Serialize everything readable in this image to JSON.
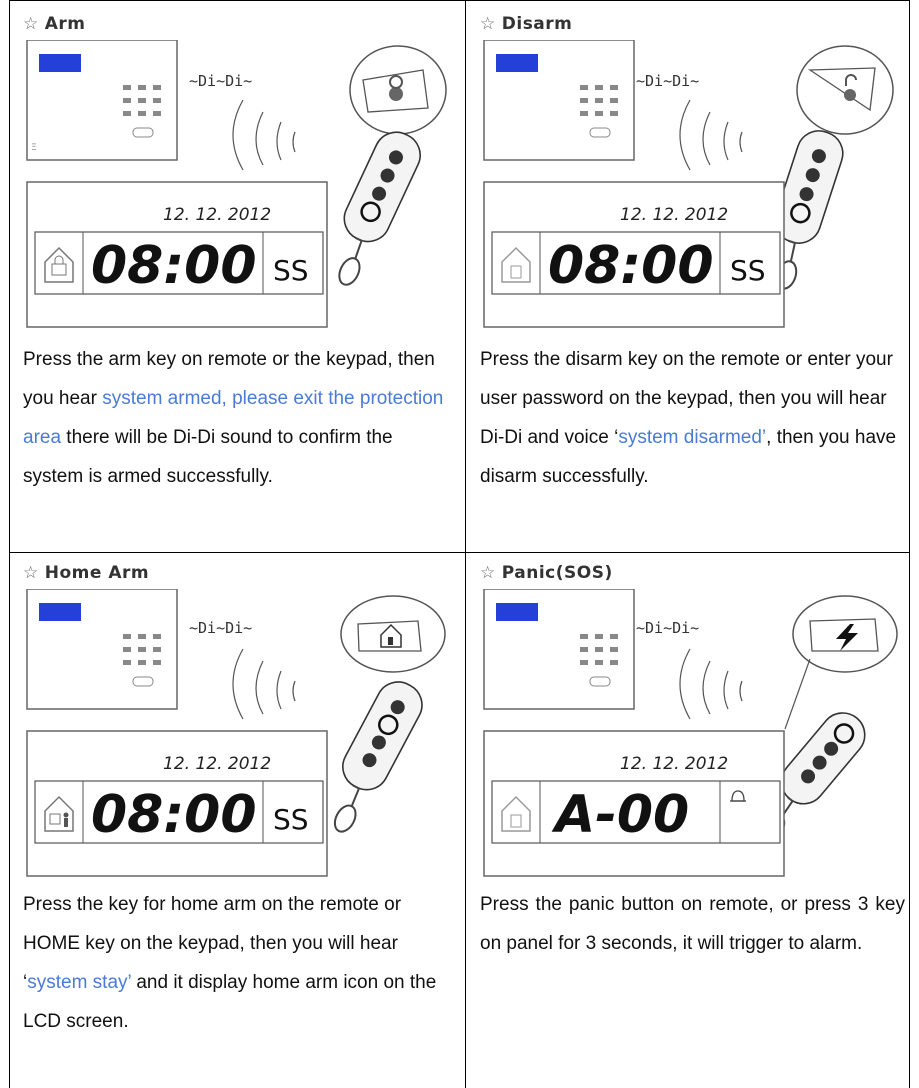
{
  "panels": [
    {
      "title": "Arm",
      "didi": "~Di~Di~",
      "date": "12. 12. 2012",
      "clock": "08:00",
      "suffix": "SS",
      "desc": {
        "p1": "Press the arm key on remote or the keypad, then you hear ",
        "h1": "system armed, please exit the protection area",
        "p2": " there will be Di-Di sound to confirm the system is armed successfully."
      }
    },
    {
      "title": "Disarm",
      "didi": "~Di~Di~",
      "date": "12. 12. 2012",
      "clock": "08:00",
      "suffix": "SS",
      "desc": {
        "p1": "Press the disarm key on the remote or enter your user password on the keypad, then you will hear Di-Di and voice ‘",
        "h1": "system disarmed’",
        "p2": ", then you have disarm successfully."
      }
    },
    {
      "title": "Home Arm",
      "didi": "~Di~Di~",
      "date": "12. 12. 2012",
      "clock": "08:00",
      "suffix": "SS",
      "desc": {
        "p1": "Press the key for home arm on the remote or HOME key on the keypad, then you will hear ‘",
        "h1": "system stay’",
        "p2": " and it display home arm icon on the LCD screen."
      }
    },
    {
      "title": "Panic(SOS)",
      "didi": "~Di~Di~",
      "date": "12. 12. 2012",
      "clock": "A-00",
      "suffix": "",
      "desc": {
        "p1": "Press the panic button on remote, or press 3 key on panel for 3 seconds, it will trigger to alarm.",
        "h1": "",
        "p2": ""
      }
    }
  ],
  "icons": [
    "lock-icon",
    "unlock-icon",
    "home-icon",
    "lightning-icon",
    "remote-control-icon",
    "alarm-panel-icon"
  ],
  "colors": {
    "highlight": "#4a7bd6",
    "lcd_blue": "#2540d8",
    "line": "#000000"
  }
}
